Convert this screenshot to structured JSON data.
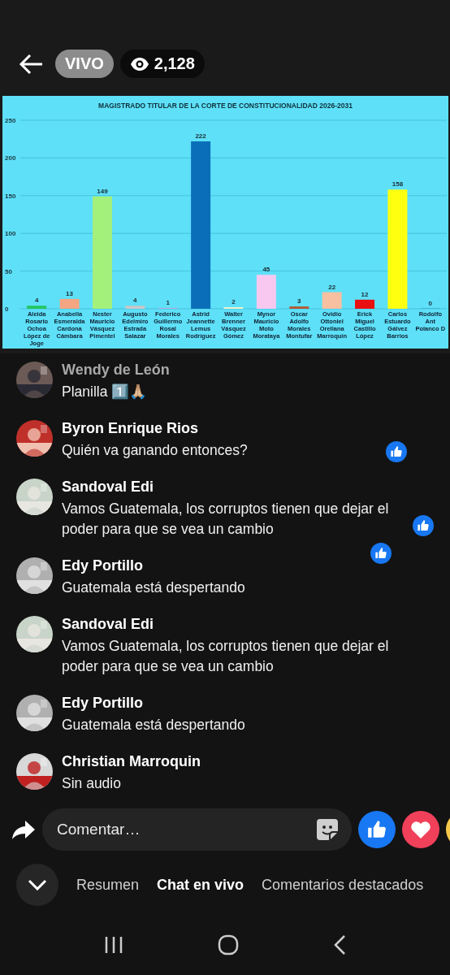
{
  "header": {
    "live_badge": "VIVO",
    "viewers": "2,128"
  },
  "chart": {
    "chart_data": {
      "type": "bar",
      "title": "MAGISTRADO TITULAR DE LA CORTE DE CONSTITUCIONALIDAD 2026-2031",
      "categories": [
        "Aleida Rosario Ochoa López de Joge",
        "Anabella Esmeralda Cardona Cámbara",
        "Nester Mauricio Vásquez Pimentel",
        "Augusto Edelmiro Estrada Salazar",
        "Federico Guillermo Rosal Morales",
        "Astrid Jeannette Lemus Rodríguez",
        "Walter Brenner Vásquez Gómez",
        "Mynor Mauricio Moto Morataya",
        "Oscar Adolfo Morales Montufar",
        "Ovidio Ottoniel Orellana Marroquín",
        "Erick Miguel Castillo López",
        "Carlos Estuardo Gálvez Barrios",
        "Rodolfo Ant Polanco D"
      ],
      "values": [
        4,
        13,
        149,
        4,
        1,
        222,
        2,
        45,
        3,
        22,
        12,
        158,
        0
      ],
      "colors": [
        "#22c55e",
        "#f4a582",
        "#a3f07a",
        "#c8c8c8",
        "#c9a0dc",
        "#0a6fb8",
        "#f5f5c8",
        "#f8c8f0",
        "#b5562e",
        "#f7c0a0",
        "#e81010",
        "#ffff10",
        "#3fb6d2"
      ],
      "ylim": [
        0,
        250
      ],
      "yticks": [
        0,
        50,
        100,
        150,
        200,
        250
      ],
      "grid": true,
      "data_labels": true
    }
  },
  "comments": [
    {
      "name": "Wendy de León",
      "text": "Planilla 1️⃣🙏🏼",
      "faded": true
    },
    {
      "name": "Byron Enrique Rios",
      "text": "Quién va ganando entonces?",
      "faded": false
    },
    {
      "name": "Sandoval Edi",
      "text": "Vamos Guatemala, los corruptos tienen que dejar el poder para que se vea un cambio",
      "faded": false
    },
    {
      "name": "Edy Portillo",
      "text": "Guatemala está despertando",
      "faded": false
    },
    {
      "name": "Sandoval Edi",
      "text": "Vamos Guatemala, los corruptos tienen que dejar el poder para que se vea un cambio",
      "faded": false
    },
    {
      "name": "Edy Portillo",
      "text": "Guatemala está despertando",
      "faded": false
    },
    {
      "name": "Christian Marroquin",
      "text": "Sin audio",
      "faded": false
    }
  ],
  "composer": {
    "placeholder": "Comentar…"
  },
  "tabs": [
    {
      "label": "Resumen",
      "selected": false
    },
    {
      "label": "Chat en vivo",
      "selected": true
    },
    {
      "label": "Comentarios destacados",
      "selected": false
    }
  ]
}
